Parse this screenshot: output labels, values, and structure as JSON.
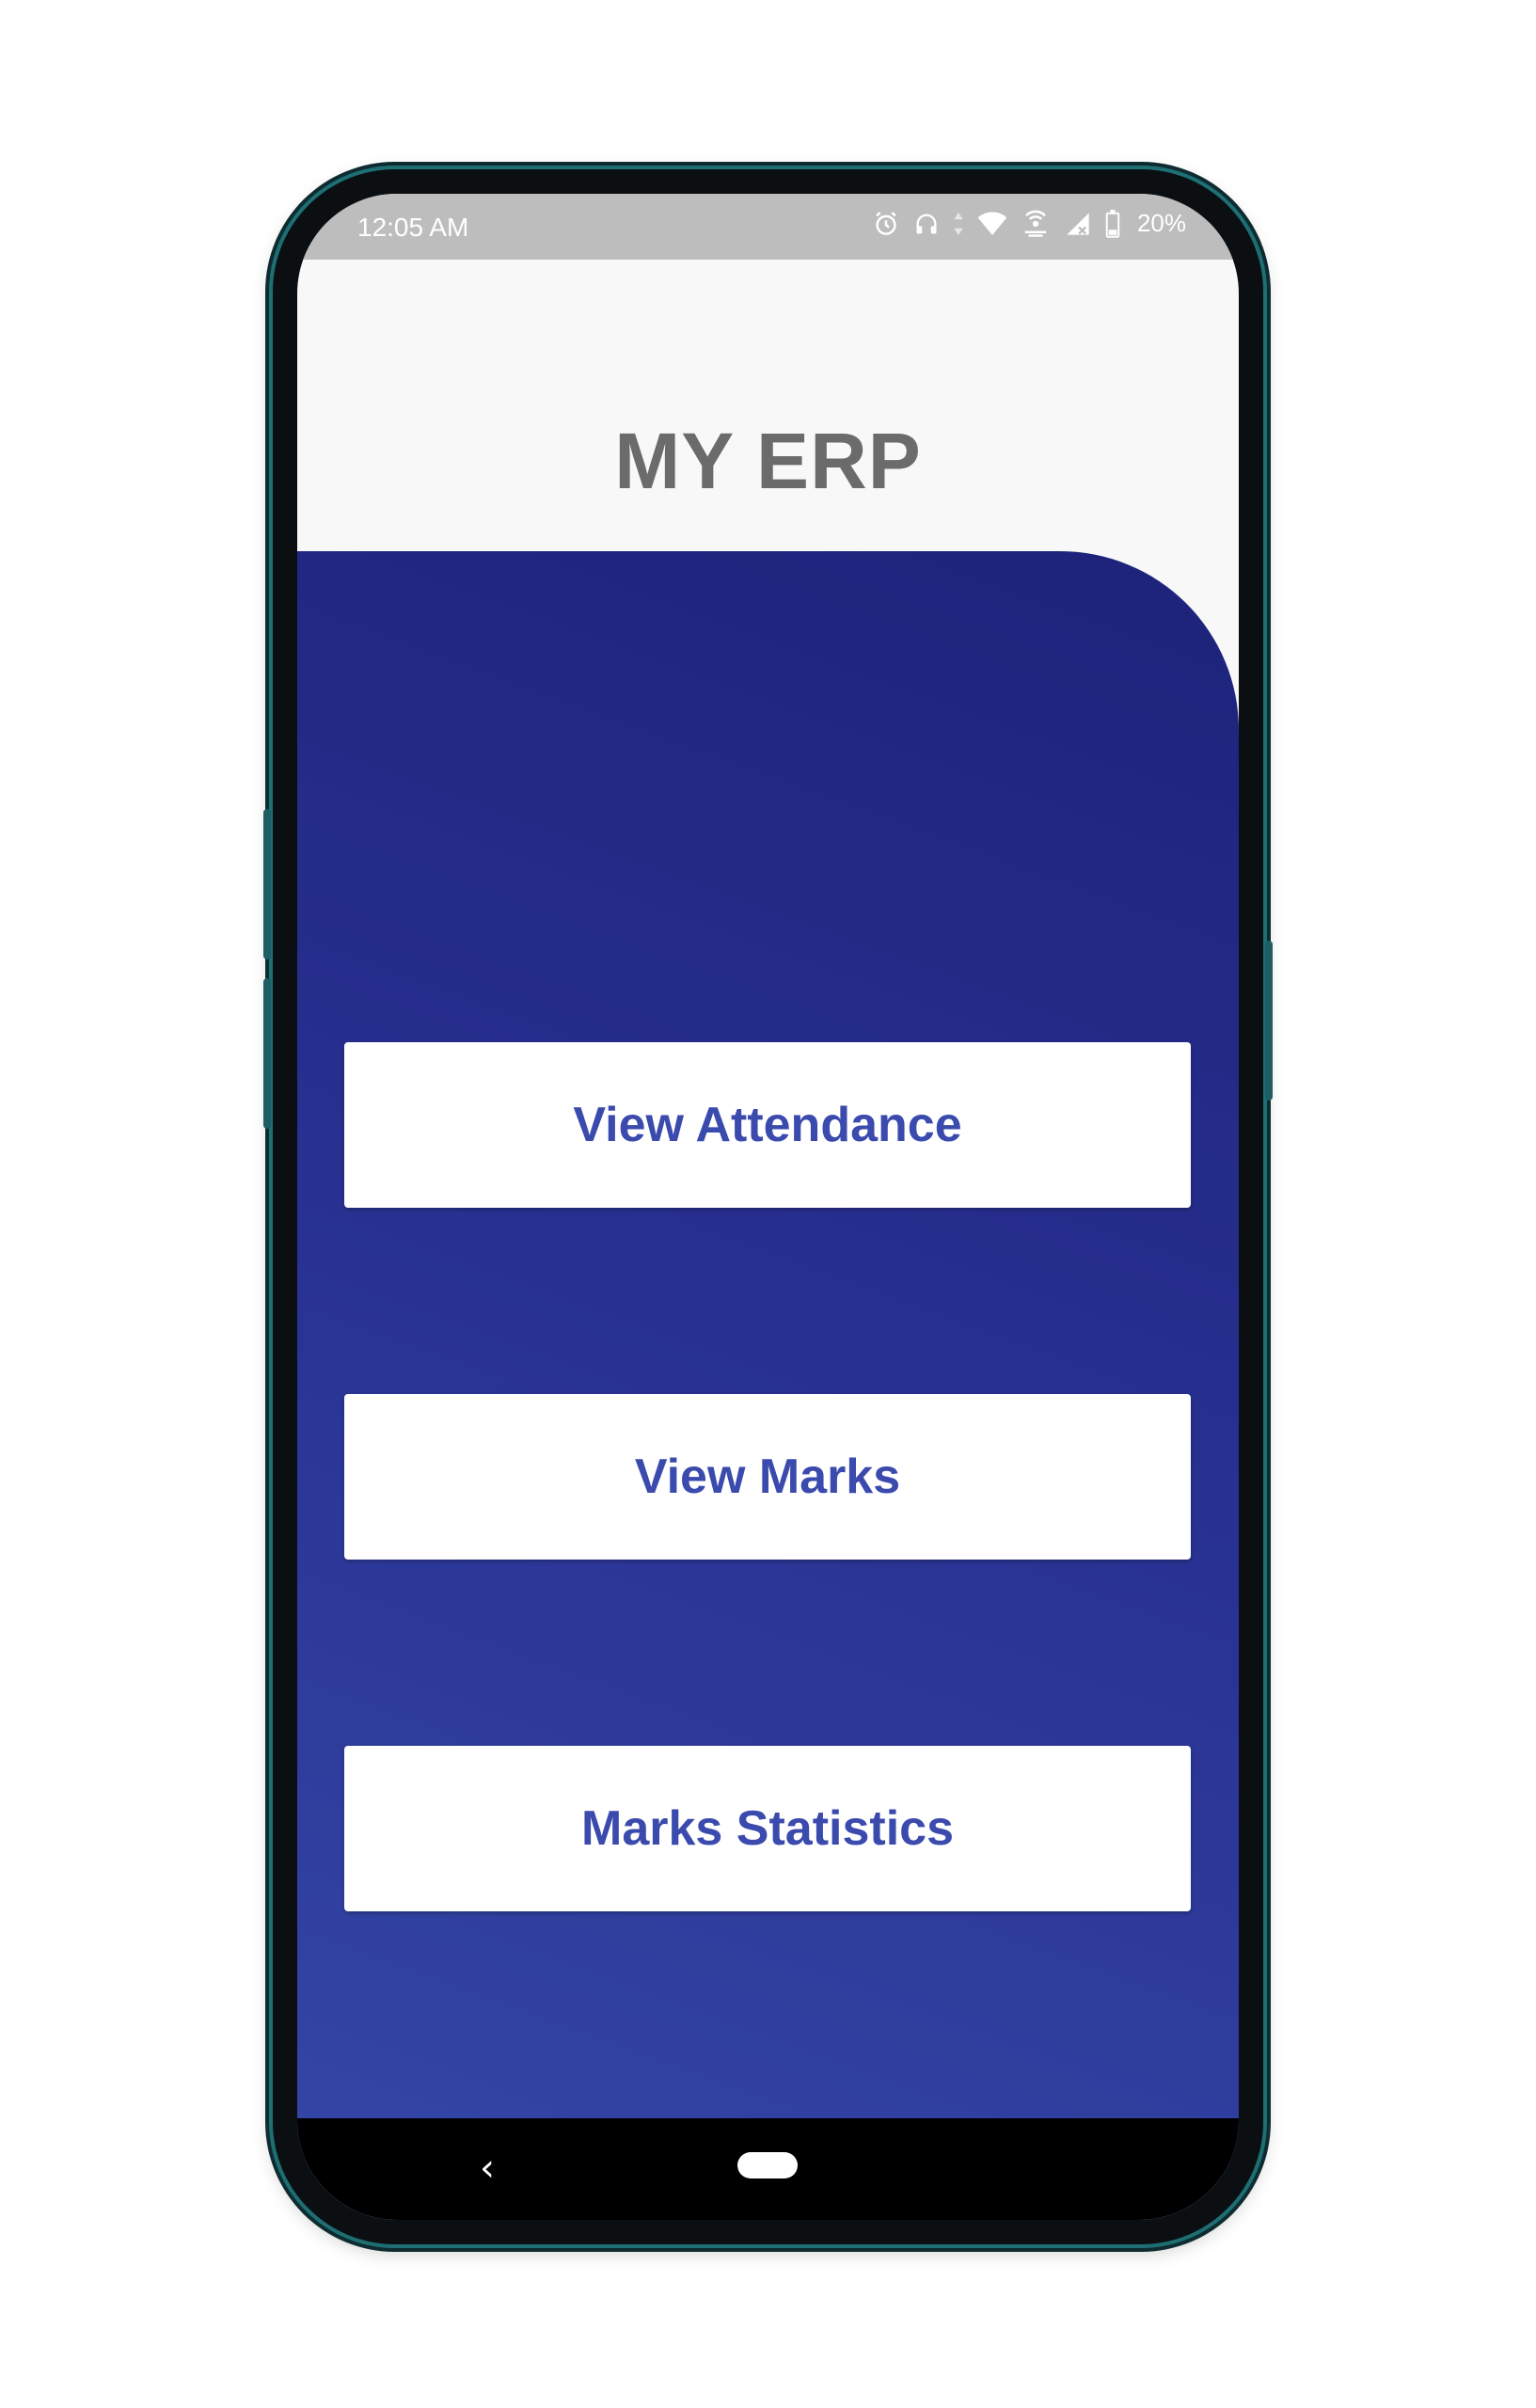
{
  "status_bar": {
    "time": "12:05 AM",
    "battery_percent": "20%",
    "icons": [
      "alarm-icon",
      "headphones-icon",
      "data-arrows-icon",
      "wifi-icon",
      "hotspot-icon",
      "signal-icon",
      "battery-icon"
    ]
  },
  "app": {
    "title": "MY ERP"
  },
  "menu": {
    "view_attendance": "View Attendance",
    "view_marks": "View Marks",
    "marks_statistics": "Marks Statistics"
  },
  "nav_bar": {
    "back_glyph": "‹"
  },
  "colors": {
    "panel_gradient_top": "#1d237a",
    "panel_gradient_bottom": "#3446a6",
    "button_text": "#3b4aad",
    "title_text": "#6b6b6b",
    "status_bar": "#bdbdbd"
  }
}
